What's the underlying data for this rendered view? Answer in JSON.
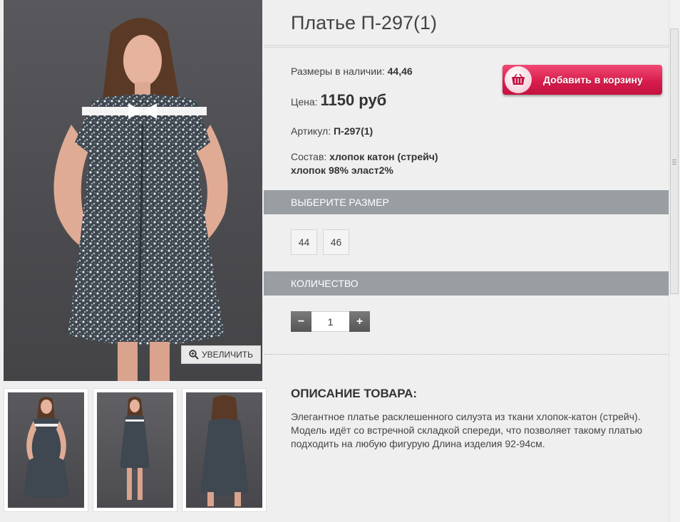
{
  "product": {
    "title": "Платье П-297(1)",
    "sizes_label": "Размеры в наличии:",
    "sizes_value": "44,46",
    "price_label": "Цена:",
    "price_value": "1150 руб",
    "article_label": "Артикул:",
    "article_value": "П-297(1)",
    "composition_label": "Состав:",
    "composition_value": "хлопок катон (стрейч)",
    "composition_line2": "хлопок 98% эласт2%"
  },
  "cart_button": {
    "label": "Добавить в корзину",
    "icon": "basket-icon"
  },
  "gallery": {
    "zoom_label": "УВЕЛИЧИТЬ",
    "zoom_icon": "zoom-in-icon"
  },
  "size_section": {
    "title": "ВЫБЕРИТЕ РАЗМЕР",
    "options": [
      "44",
      "46"
    ]
  },
  "quantity_section": {
    "title": "КОЛИЧЕСТВО",
    "minus": "−",
    "plus": "+",
    "value": "1"
  },
  "description": {
    "title": "ОПИСАНИЕ ТОВАРА:",
    "text": "Элегантное платье расклешенного силуэта из ткани хлопок-катон (стрейч). Модель идёт со встречной складкой спереди, что позволяет такому платью подходить на любую фигурую Длина изделия 92-94см."
  },
  "colors": {
    "cart_button": "#d81d4d",
    "section_bar": "#999ea2",
    "photo_background": "#4b4b4f"
  }
}
